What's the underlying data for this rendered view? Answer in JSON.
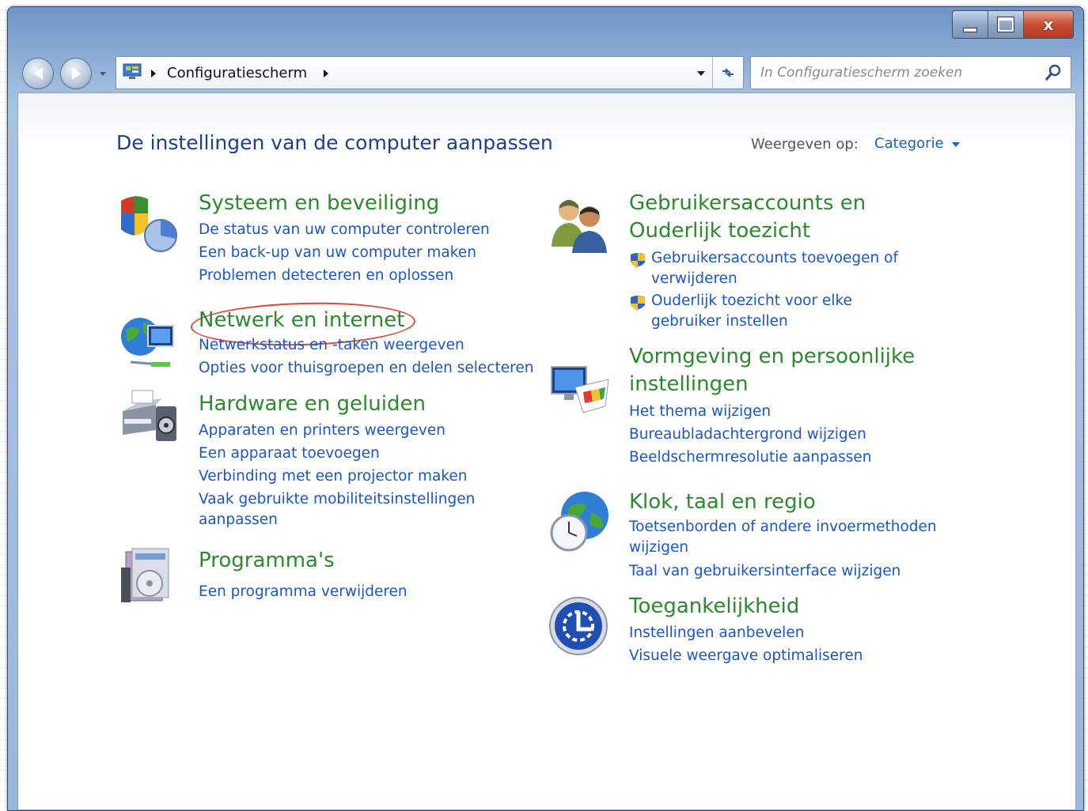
{
  "window": {
    "breadcrumb": "Configuratiescherm",
    "search_placeholder": "In Configuratiescherm zoeken",
    "close_glyph": "x"
  },
  "content": {
    "title": "De instellingen van de computer aanpassen",
    "view_label": "Weergeven op:",
    "view_value": "Categorie"
  },
  "categories_left": [
    {
      "title": "Systeem en beveiliging",
      "icon": "shield-chart-icon",
      "links": [
        "De status van uw computer controleren",
        "Een back-up van uw computer maken",
        "Problemen detecteren en oplossen"
      ]
    },
    {
      "title": "Netwerk en internet",
      "icon": "globe-network-icon",
      "highlighted": true,
      "links": [
        "Netwerkstatus en -taken weergeven",
        "Opties voor thuisgroepen en delen selecteren"
      ]
    },
    {
      "title": "Hardware en geluiden",
      "icon": "printer-speaker-icon",
      "links": [
        "Apparaten en printers weergeven",
        "Een apparaat toevoegen",
        "Verbinding met een projector maken",
        "Vaak gebruikte mobiliteitsinstellingen aanpassen"
      ]
    },
    {
      "title": "Programma's",
      "icon": "programs-disc-icon",
      "links": [
        "Een programma verwijderen"
      ]
    }
  ],
  "categories_right": [
    {
      "title": "Gebruikersaccounts en Ouderlijk toezicht",
      "icon": "users-icon",
      "links": [
        "Gebruikersaccounts toevoegen of verwijderen",
        "Ouderlijk toezicht voor elke gebruiker instellen"
      ]
    },
    {
      "title": "Vormgeving en persoonlijke instellingen",
      "icon": "monitor-palette-icon",
      "links": [
        "Het thema wijzigen",
        "Bureaubladachtergrond wijzigen",
        "Beeldschermresolutie aanpassen"
      ]
    },
    {
      "title": "Klok, taal en regio",
      "icon": "globe-clock-icon",
      "links": [
        "Toetsenborden of andere invoermethoden wijzigen",
        "Taal van gebruikersinterface wijzigen"
      ]
    },
    {
      "title": "Toegankelijkheid",
      "icon": "accessibility-icon",
      "links": [
        "Instellingen aanbevelen",
        "Visuele weergave optimaliseren"
      ]
    }
  ],
  "colors": {
    "category_title": "#2b8a2b",
    "link": "#1a56c8",
    "page_title": "#1e3f8a",
    "highlight_ring": "#e0453a"
  }
}
